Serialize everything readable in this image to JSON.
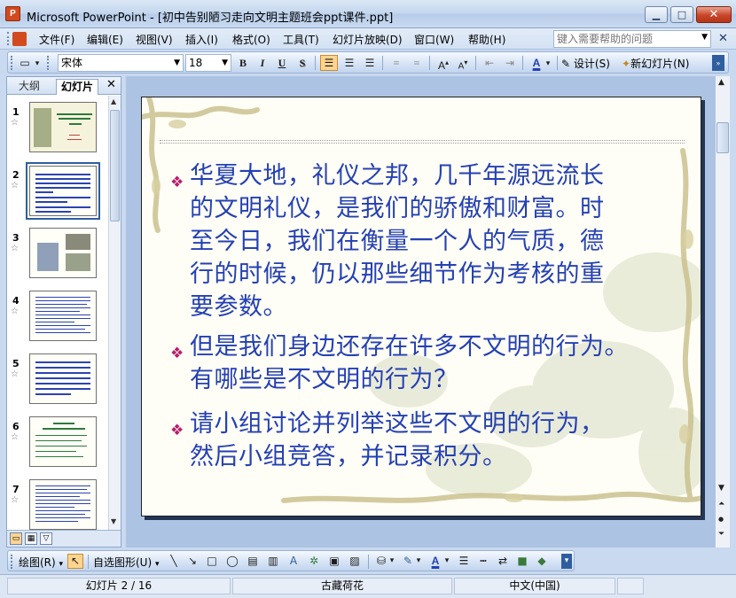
{
  "window": {
    "title": "Microsoft PowerPoint - [初中告别陋习走向文明主题班会ppt课件.ppt]",
    "app_icon_letter": "P"
  },
  "menu": {
    "items": [
      "文件(F)",
      "编辑(E)",
      "视图(V)",
      "插入(I)",
      "格式(O)",
      "工具(T)",
      "幻灯片放映(D)",
      "窗口(W)",
      "帮助(H)"
    ],
    "help_placeholder": "键入需要帮助的问题"
  },
  "format_toolbar": {
    "font_name": "宋体",
    "font_size": "18",
    "bold": "B",
    "italic": "I",
    "underline": "U",
    "shadow": "S",
    "design_label": "设计(S)",
    "new_slide_label": "新幻灯片(N)"
  },
  "left_panel": {
    "tab_outline": "大纲",
    "tab_slides": "幻灯片",
    "slide_numbers": [
      "1",
      "2",
      "3",
      "4",
      "5",
      "6",
      "7"
    ],
    "selected_slide": 2
  },
  "slide": {
    "bullets": [
      "华夏大地，礼仪之邦，几千年源远流长\n的文明礼仪，是我们的骄傲和财富。时\n至今日，我们在衡量一个人的气质，德\n行的时候，仍以那些细节作为考核的重\n要参数。",
      " 但是我们身边还存在许多不文明的行为。\n有哪些是不文明的行为？",
      "请小组讨论并列举这些不文明的行为，\n然后小组竞答，并记录积分。"
    ],
    "bullet_symbol": "❖",
    "text_color": "#2440b3",
    "bullet_color": "#b5206b"
  },
  "drawing_toolbar": {
    "draw_label": "绘图(R)",
    "autoshapes_label": "自选图形(U)"
  },
  "status": {
    "slide_position": "幻灯片 2 / 16",
    "design_name": "古藏荷花",
    "language": "中文(中国)"
  }
}
